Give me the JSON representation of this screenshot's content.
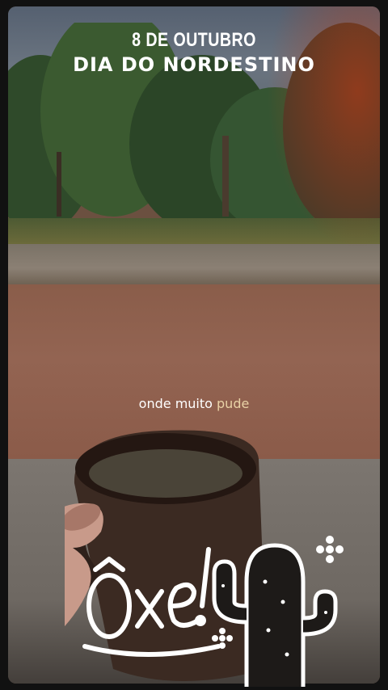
{
  "header": {
    "date": "8 DE OUTUBRO",
    "title": "DIA DO NORDESTINO"
  },
  "caption": {
    "text_main": "onde muito",
    "text_highlight": "pude"
  },
  "sticker": {
    "text": "Ôxe!",
    "icon": "cactus-icon",
    "decor": [
      "flower-icon",
      "flower-icon"
    ]
  },
  "colors": {
    "text": "#ffffff",
    "highlight": "#e9d2a6"
  }
}
